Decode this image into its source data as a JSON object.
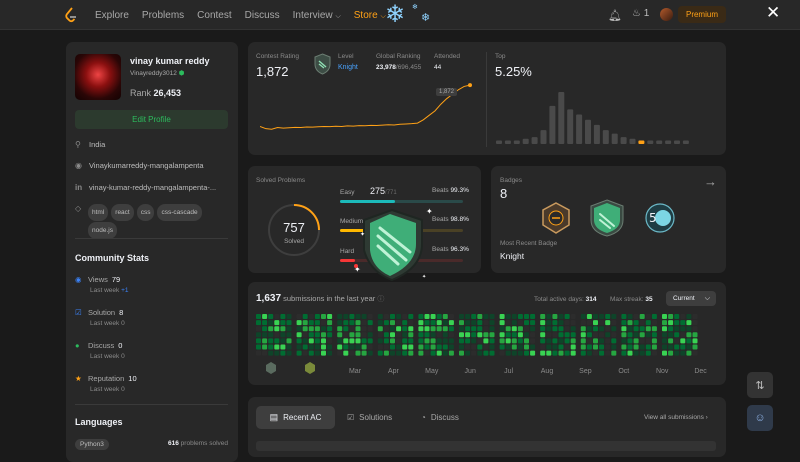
{
  "nav": {
    "items": [
      "Explore",
      "Problems",
      "Contest",
      "Discuss",
      "Interview",
      "Store"
    ],
    "streak": "1",
    "premium": "Premium"
  },
  "profile": {
    "name": "vinay kumar reddy",
    "username": "Vinayreddy3012",
    "rank_label": "Rank",
    "rank_value": "26,453",
    "edit_label": "Edit Profile",
    "location": "India",
    "github": "Vinaykumarreddy-mangalampenta",
    "linkedin": "vinay-kumar-reddy-mangalampenta-...",
    "skills": [
      "html",
      "react",
      "css",
      "css-cascade",
      "node.js"
    ]
  },
  "community": {
    "title": "Community Stats",
    "stats": [
      {
        "label": "Views",
        "value": "79",
        "sub_label": "Last week",
        "sub_value": "+1",
        "color": "#3b82f6"
      },
      {
        "label": "Solution",
        "value": "8",
        "sub_label": "Last week",
        "sub_value": "0",
        "color": "#3b82f6"
      },
      {
        "label": "Discuss",
        "value": "0",
        "sub_label": "Last week",
        "sub_value": "0",
        "color": "#2cbb5d"
      },
      {
        "label": "Reputation",
        "value": "10",
        "sub_label": "Last week",
        "sub_value": "0",
        "color": "#ffa116"
      }
    ]
  },
  "languages": {
    "title": "Languages",
    "items": [
      {
        "name": "Python3",
        "count": "616",
        "suffix": "problems solved"
      }
    ]
  },
  "contest": {
    "rating_label": "Contest Rating",
    "rating": "1,872",
    "level_label": "Level",
    "level": "Knight",
    "ranking_label": "Global Ranking",
    "ranking": "23,978",
    "ranking_total": "/696,455",
    "attended_label": "Attended",
    "attended": "44",
    "marker_label": "1,872",
    "top_label": "Top",
    "top_value": "5.25%",
    "rating_series": [
      1500,
      1480,
      1475,
      1490,
      1485,
      1488,
      1492,
      1490,
      1495,
      1494,
      1497,
      1500,
      1498,
      1502,
      1500,
      1505,
      1503,
      1507,
      1506,
      1510,
      1508,
      1512,
      1515,
      1513,
      1520,
      1522,
      1525,
      1530,
      1560,
      1600,
      1640,
      1700,
      1750,
      1790,
      1830,
      1860,
      1872
    ],
    "histogram": [
      2,
      2,
      2,
      3,
      4,
      8,
      22,
      30,
      20,
      17,
      14,
      11,
      8,
      6,
      4,
      3,
      2,
      2,
      2,
      2,
      2,
      2
    ],
    "highlight_bin": 16
  },
  "solved": {
    "title": "Solved Problems",
    "total": "757",
    "total_label": "Solved",
    "beats_label": "Beats",
    "easy_label": "Easy",
    "easy": "275",
    "easy_total": "/771",
    "easy_beats": "99.3%",
    "medium_label": "Medium",
    "medium": "401",
    "medium_beats": "98.8%",
    "hard_label": "Hard",
    "hard": "81",
    "hard_beats": "96.3%"
  },
  "badges": {
    "title": "Badges",
    "count": "8",
    "recent_label": "Most Recent Badge",
    "recent": "Knight"
  },
  "submissions": {
    "count": "1,637",
    "label": "submissions in the last year",
    "active_days_label": "Total active days:",
    "active_days": "314",
    "max_streak_label": "Max streak:",
    "max_streak": "35",
    "dropdown": "Current",
    "months": [
      "Mar",
      "Apr",
      "May",
      "Jun",
      "Jul",
      "Aug",
      "Sep",
      "Oct",
      "Nov",
      "Dec"
    ]
  },
  "recent": {
    "tabs": [
      "Recent AC",
      "Solutions",
      "Discuss"
    ],
    "view_all": "View all submissions"
  },
  "colors": {
    "accent": "#ffa116",
    "green": "#2cbb5d",
    "easy": "#1cbaba",
    "medium": "#ffb800",
    "hard": "#f63737"
  }
}
